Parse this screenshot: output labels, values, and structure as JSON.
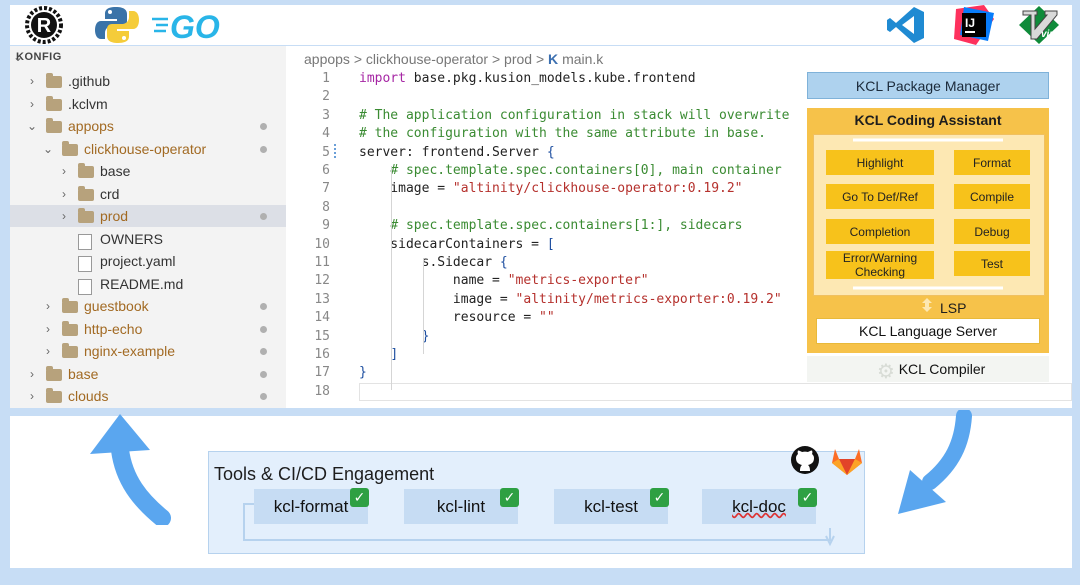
{
  "explorer": {
    "title": "KONFIG",
    "items": [
      {
        "label": ".github",
        "depth": 1,
        "kind": "folder",
        "chevron": "closed",
        "modified": false,
        "icon": "github-folder-icon"
      },
      {
        "label": ".kclvm",
        "depth": 1,
        "kind": "folder",
        "chevron": "closed",
        "modified": false,
        "icon": "folder-icon"
      },
      {
        "label": "appops",
        "depth": 1,
        "kind": "folder",
        "chevron": "open",
        "modified": true,
        "icon": "folder-open-icon"
      },
      {
        "label": "clickhouse-operator",
        "depth": 2,
        "kind": "folder",
        "chevron": "open",
        "modified": true,
        "icon": "folder-open-icon"
      },
      {
        "label": "base",
        "depth": 3,
        "kind": "folder",
        "chevron": "closed",
        "modified": false,
        "icon": "folder-icon"
      },
      {
        "label": "crd",
        "depth": 3,
        "kind": "folder",
        "chevron": "closed",
        "modified": false,
        "icon": "folder-icon"
      },
      {
        "label": "prod",
        "depth": 3,
        "kind": "folder",
        "chevron": "closed",
        "modified": true,
        "icon": "folder-icon",
        "selected": true
      },
      {
        "label": "OWNERS",
        "depth": 3,
        "kind": "file",
        "modified": false,
        "icon": "file-icon"
      },
      {
        "label": "project.yaml",
        "depth": 3,
        "kind": "file",
        "modified": false,
        "icon": "yaml-file-icon"
      },
      {
        "label": "README.md",
        "depth": 3,
        "kind": "file",
        "modified": false,
        "icon": "markdown-file-icon"
      },
      {
        "label": "guestbook",
        "depth": 2,
        "kind": "folder",
        "chevron": "closed",
        "modified": true,
        "icon": "folder-icon"
      },
      {
        "label": "http-echo",
        "depth": 2,
        "kind": "folder",
        "chevron": "closed",
        "modified": true,
        "icon": "folder-icon"
      },
      {
        "label": "nginx-example",
        "depth": 2,
        "kind": "folder",
        "chevron": "closed",
        "modified": true,
        "icon": "folder-icon"
      },
      {
        "label": "base",
        "depth": 1,
        "kind": "folder",
        "chevron": "closed",
        "modified": true,
        "icon": "folder-icon"
      },
      {
        "label": "clouds",
        "depth": 1,
        "kind": "folder",
        "chevron": "closed",
        "modified": true,
        "icon": "folder-icon"
      }
    ]
  },
  "breadcrumb": {
    "parts": [
      "appops",
      "clickhouse-operator",
      "prod"
    ],
    "separator": ">",
    "file_icon": "K",
    "file": "main.k"
  },
  "code": [
    {
      "n": "1",
      "segs": [
        [
          "kw",
          "import"
        ],
        [
          "",
          " base.pkg.kusion_models.kube.frontend"
        ]
      ]
    },
    {
      "n": "2",
      "segs": []
    },
    {
      "n": "3",
      "segs": [
        [
          "cm",
          "# The application configuration in stack will overwrite"
        ]
      ]
    },
    {
      "n": "4",
      "segs": [
        [
          "cm",
          "# the configuration with the same attribute in base."
        ]
      ]
    },
    {
      "n": "5",
      "segs": [
        [
          "",
          "server: frontend.Server "
        ],
        [
          "sy",
          "{"
        ]
      ]
    },
    {
      "n": "6",
      "segs": [
        [
          "",
          "    "
        ],
        [
          "cm",
          "# spec.template.spec.containers[0], main container"
        ]
      ]
    },
    {
      "n": "7",
      "segs": [
        [
          "",
          "    image = "
        ],
        [
          "st",
          "\"altinity/clickhouse-operator:0.19.2\""
        ]
      ]
    },
    {
      "n": "8",
      "segs": []
    },
    {
      "n": "9",
      "segs": [
        [
          "",
          "    "
        ],
        [
          "cm",
          "# spec.template.spec.containers[1:], sidecars"
        ]
      ]
    },
    {
      "n": "10",
      "segs": [
        [
          "",
          "    sidecarContainers = "
        ],
        [
          "sy",
          "["
        ]
      ]
    },
    {
      "n": "11",
      "segs": [
        [
          "",
          "        s.Sidecar "
        ],
        [
          "sy",
          "{"
        ]
      ]
    },
    {
      "n": "12",
      "segs": [
        [
          "",
          "            name = "
        ],
        [
          "st",
          "\"metrics-exporter\""
        ]
      ]
    },
    {
      "n": "13",
      "segs": [
        [
          "",
          "            image = "
        ],
        [
          "st",
          "\"altinity/metrics-exporter:0.19.2\""
        ]
      ]
    },
    {
      "n": "14",
      "segs": [
        [
          "",
          "            resource = "
        ],
        [
          "st",
          "\"\""
        ]
      ]
    },
    {
      "n": "15",
      "segs": [
        [
          "",
          "        "
        ],
        [
          "sy",
          "}"
        ]
      ]
    },
    {
      "n": "16",
      "segs": [
        [
          "",
          "    "
        ],
        [
          "sy",
          "]"
        ]
      ]
    },
    {
      "n": "17",
      "segs": [
        [
          "sy",
          "}"
        ]
      ]
    },
    {
      "n": "18",
      "segs": []
    }
  ],
  "kcl": {
    "package_manager": "KCL Package Manager",
    "assistant_title": "KCL Coding Assistant",
    "features_left": [
      "Highlight",
      "Go To Def/Ref",
      "Completion",
      "Error/Warning\nChecking"
    ],
    "features_right": [
      "Format",
      "Compile",
      "Debug",
      "Test"
    ],
    "lsp": "LSP",
    "language_server": "KCL Language Server",
    "compiler": "KCL Compiler"
  },
  "tools": {
    "title": "Tools & CI/CD Engagement",
    "items": [
      "kcl-format",
      "kcl-lint",
      "kcl-test",
      "kcl-doc"
    ],
    "check_glyph": "✓"
  },
  "logos": {
    "rust_letter": "R",
    "go_text": "GO",
    "intellij_text": "IJ",
    "vim_text": "vim"
  },
  "colors": {
    "kcl_orange": "#f6c24a",
    "feature_yellow": "#f7c21b",
    "tool_blue": "#c6dcf3",
    "arrow_blue": "#5aa6ef",
    "check_green": "#2ea043",
    "background": "#c7ddf5"
  }
}
